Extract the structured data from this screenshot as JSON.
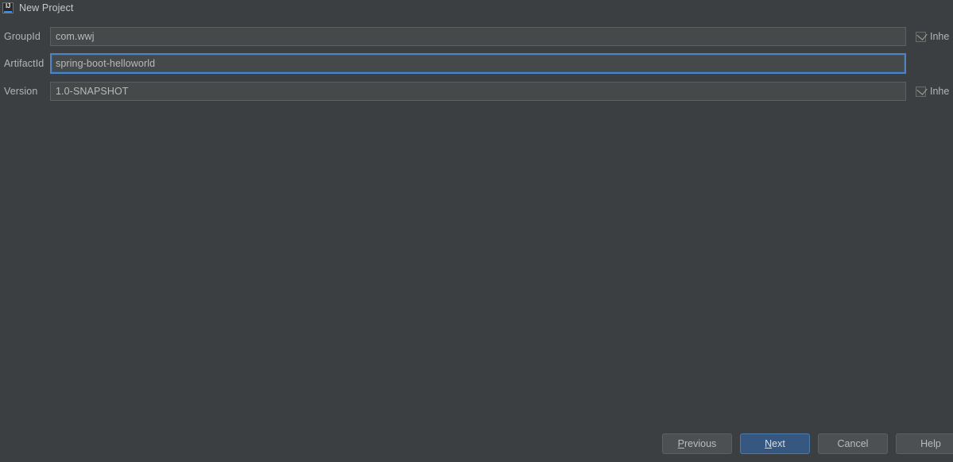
{
  "window": {
    "title": "New Project",
    "icon": "intellij-idea-icon",
    "icon_text": "IJ"
  },
  "form": {
    "fields": [
      {
        "label": "GroupId",
        "value": "com.wwj",
        "placeholder": "",
        "focused": false,
        "inherit": {
          "label": "Inhe",
          "checked": true
        }
      },
      {
        "label": "ArtifactId",
        "value": "spring-boot-helloworld",
        "placeholder": "",
        "focused": true,
        "inherit": null
      },
      {
        "label": "Version",
        "value": "1.0-SNAPSHOT",
        "placeholder": "",
        "focused": false,
        "inherit": {
          "label": "Inhe",
          "checked": true
        }
      }
    ]
  },
  "buttons": {
    "previous": {
      "mnemonic": "P",
      "rest": "revious"
    },
    "next": {
      "mnemonic": "N",
      "rest": "ext"
    },
    "cancel": {
      "label": "Cancel"
    },
    "help": {
      "label": "Help"
    }
  },
  "colors": {
    "background": "#3c3f41",
    "field_background": "#45494a",
    "field_border": "#5e6060",
    "focus_border": "#4e84c4",
    "default_button": "#365880",
    "text": "#bbbbbb",
    "accent": "#3592ff"
  }
}
